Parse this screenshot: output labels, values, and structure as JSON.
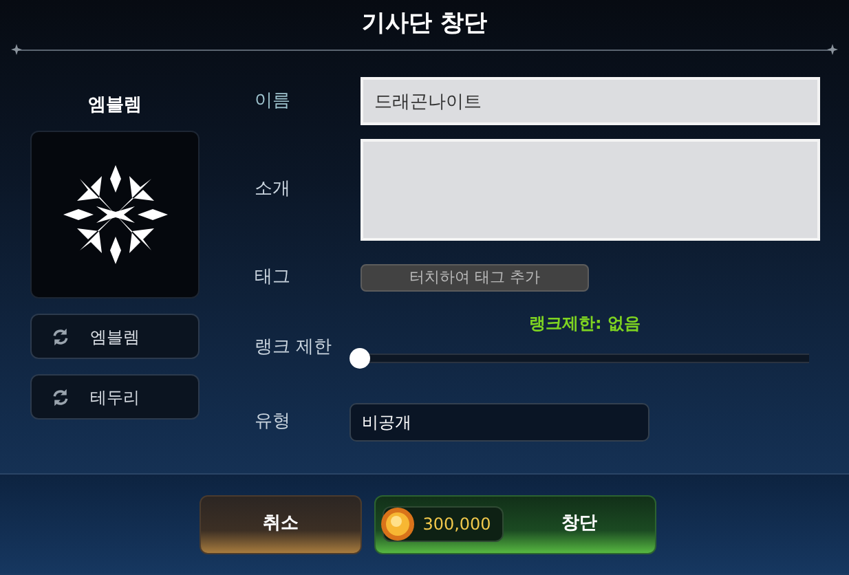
{
  "window": {
    "title": "기사단 창단"
  },
  "emblem": {
    "label": "엠블렘"
  },
  "emblem_buttons": [
    {
      "label": "엠블렘"
    },
    {
      "label": "테두리"
    }
  ],
  "form": {
    "name": {
      "label": "이름",
      "value": "드래곤나이트"
    },
    "intro": {
      "label": "소개"
    },
    "tag": {
      "label": "태그",
      "button": "터치하여 태그 추가"
    },
    "rank": {
      "label": "랭크 제한",
      "reading": "랭크제한: 없음",
      "level": 0
    },
    "type": {
      "label": "유형",
      "value": "비공개"
    }
  },
  "footer": {
    "cancel": "취소",
    "create": "창단",
    "cost": "300,000"
  }
}
